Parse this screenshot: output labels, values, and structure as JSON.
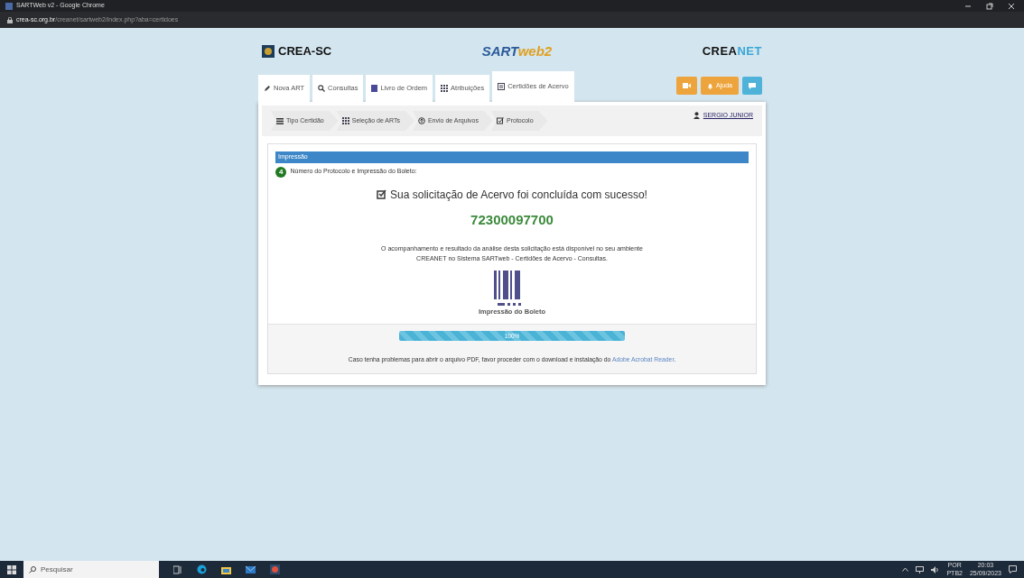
{
  "window": {
    "title": "SARTWeb v2 - Google Chrome"
  },
  "address_bar": {
    "domain": "crea-sc.org.br",
    "path": "/creanet/sartweb2/index.php?aba=certidoes"
  },
  "header": {
    "crea_logo": "CREA-SC",
    "sart_logo": [
      "SART",
      "web2"
    ],
    "creanet_logo": [
      "CREA",
      "NET"
    ]
  },
  "tabs": [
    {
      "label": "Nova ART",
      "kind": "pencil",
      "selected": false
    },
    {
      "label": "Consultas",
      "kind": "search",
      "selected": false
    },
    {
      "label": "Livro de Ordem",
      "kind": "book",
      "selected": false
    },
    {
      "label": "Atribuições",
      "kind": "grid",
      "selected": false
    },
    {
      "label": "Certidões de Acervo",
      "kind": "doc",
      "selected": true
    }
  ],
  "header_buttons": [
    {
      "kind": "video"
    },
    {
      "kind": "help",
      "label": "Ajuda"
    },
    {
      "kind": "chat"
    }
  ],
  "steps": [
    {
      "label": "Tipo Certidão",
      "kind": "list"
    },
    {
      "label": "Seleção de ARTs",
      "kind": "grid"
    },
    {
      "label": "Envio de Arquivos",
      "kind": "upload"
    },
    {
      "label": "Protocolo",
      "kind": "check"
    }
  ],
  "user": "SERGIO JUNIOR",
  "section": {
    "title": "Impressão",
    "step_number": "4",
    "step_label": "Número do Protocolo e Impressão do Boleto:",
    "success": "Sua solicitação de Acervo foi concluída com sucesso!",
    "protocol": "72300097700",
    "info": "O acompanhamento e resultado da análise desta solicitação está disponível no seu ambiente CREANET no Sistema SARTweb - Certidões de Acervo - Consultas.",
    "boleto_label": "Impressão do Boleto",
    "progress": {
      "level": 1,
      "label": "100%"
    },
    "pdf_note": "Caso tenha problemas para abrir o arquivo PDF, favor proceder com o download e instalação do ",
    "pdf_link": "Adobe Acrobat Reader",
    "pdf_end": "."
  },
  "taskbar": {
    "search_placeholder": "Pesquisar",
    "language": [
      "POR",
      "PTB2"
    ],
    "time": "20:03",
    "date": "25/09/2023"
  }
}
